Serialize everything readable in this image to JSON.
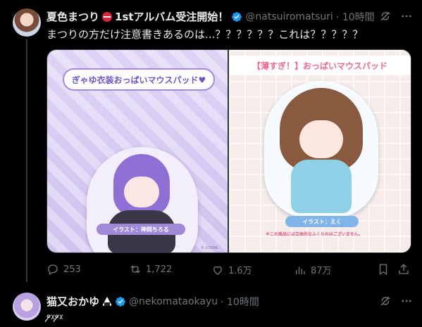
{
  "tweet1": {
    "name": "夏色まつり",
    "name_suffix": "1stアルバム受注開始！",
    "handle": "@natsuiromatsuri",
    "time": "· 10時間",
    "text": "まつりの方だけ注意書きあるのは...？？？？？？これは？？？？？",
    "media": {
      "left": {
        "title": "ぎゃゆ衣装おっぱいマウスパッド♥",
        "credit": "イラスト：神岡ちろる",
        "copyright": "© COVER"
      },
      "right": {
        "title": "【薄すぎ！】おっぱいマウスパッド",
        "credit": "イラスト：えく",
        "note": "※この商品には立体的なふくらみはございません。"
      }
    },
    "actions": {
      "replies": "253",
      "reposts": "1,722",
      "likes": "1.6万",
      "views": "87万"
    }
  },
  "tweet2": {
    "name": "猫又おかゆ",
    "handle": "@nekomataokayu",
    "time": "· 10時間",
    "text": "ᵉ̷̷̷ᵡᵉ̷̷̷ᵡ"
  },
  "colors": {
    "accent_verified": "#1d9bf0",
    "background": "#000000",
    "text_primary": "#e7e9ea",
    "text_secondary": "#71767b"
  }
}
